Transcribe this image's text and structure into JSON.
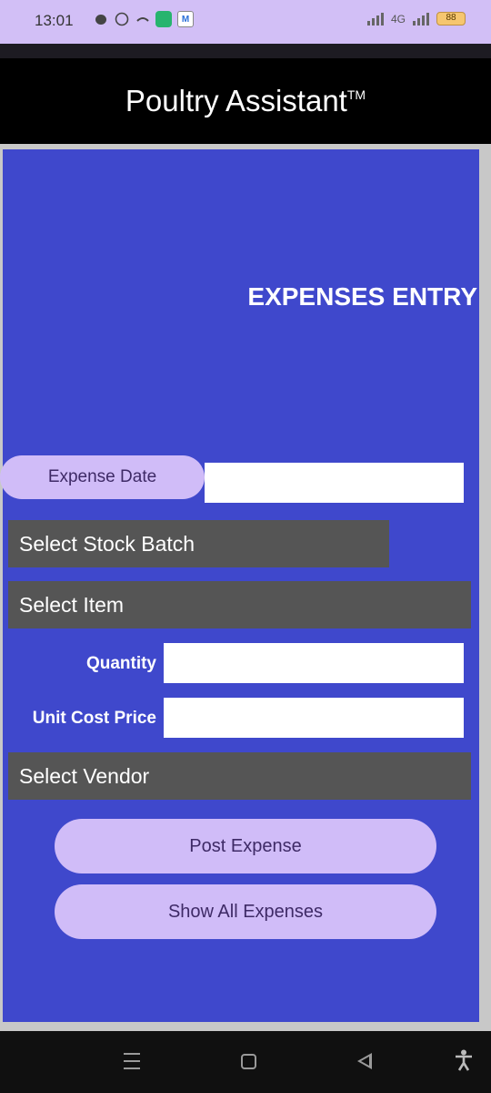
{
  "status_bar": {
    "time": "13:01",
    "mail_icon_letter": "M",
    "network": "4G",
    "battery": "88"
  },
  "app": {
    "title": "Poultry Assistant",
    "trademark": "TM"
  },
  "form": {
    "heading": "EXPENSES ENTRY",
    "expense_date_label": "Expense Date",
    "expense_date_value": "",
    "stock_batch_select": "Select Stock Batch",
    "item_select": "Select Item",
    "quantity_label": "Quantity",
    "quantity_value": "",
    "unit_cost_label": "Unit Cost Price",
    "unit_cost_value": "",
    "vendor_select": "Select Vendor",
    "post_button": "Post Expense",
    "show_all_button": "Show All Expenses"
  },
  "colors": {
    "status_bar": "#d2bff6",
    "panel_background": "#3f48cc",
    "pill_button": "#d0bcf8",
    "spinner": "#555555"
  },
  "nav_bar": {
    "icons": [
      "menu-icon",
      "home-icon",
      "back-icon",
      "accessibility-icon"
    ]
  }
}
